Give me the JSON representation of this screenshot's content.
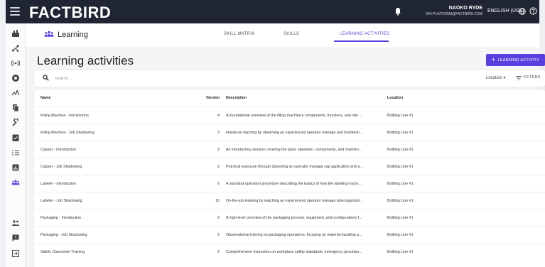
{
  "app": {
    "logo": "FACTBIRD",
    "user_name": "NAOKO RYDE",
    "user_email": "NR+PLATFORM@FACTBIRD.COM",
    "language": "ENGLISH (US)"
  },
  "sidebar": {
    "items": [
      "dashboard-icon",
      "flow-icon",
      "sensor-icon",
      "settings-dial-icon",
      "activity-icon",
      "documents-icon",
      "wrench-icon",
      "checklist-icon",
      "list-icon",
      "report-icon",
      "learning-icon",
      "people-icon",
      "feedback-icon",
      "logout-icon"
    ]
  },
  "header": {
    "section_title": "Learning",
    "tabs": [
      {
        "label": "SKILL MATRIX",
        "active": false
      },
      {
        "label": "SKILLS",
        "active": false
      },
      {
        "label": "LEARNING ACTIVITIES",
        "active": true
      }
    ]
  },
  "main": {
    "title": "Learning activities",
    "add_button_label": "LEARNING ACTIVITY",
    "search_placeholder": "Search...",
    "location_filter_label": "Location",
    "filters_label": "FILTERS"
  },
  "table": {
    "columns": [
      "Name",
      "Version",
      "Description",
      "Location"
    ],
    "rows": [
      {
        "name": "Filling Machine - Introduction",
        "version": "4",
        "description": "A foundational overview of the filling machine's components, functions, and role ...",
        "location": "Bottling Line #1"
      },
      {
        "name": "Filling Machine - Job Shadowing",
        "version": "3",
        "description": "Hands-on learning by observing an experienced operator manage and troublesh...",
        "location": "Bottling Line #1"
      },
      {
        "name": "Capper - Introduction",
        "version": "2",
        "description": "An introductory session covering the basic operation, components, and mainten...",
        "location": "Bottling Line #1"
      },
      {
        "name": "Capper - Job Shadowing",
        "version": "2",
        "description": "Practical exposure through observing an operator manage cap application and a...",
        "location": "Bottling Line #1"
      },
      {
        "name": "Labeler - Introduction",
        "version": "6",
        "description": "A standard operation procedure describing the basics of how the labeling machi...",
        "location": "Bottling Line #1"
      },
      {
        "name": "Labeler - Job Shadowing",
        "version": "10",
        "description": "On-the-job learning by watching an experienced operator manage label applicati...",
        "location": "Bottling Line #1"
      },
      {
        "name": "Packaging - Introduction",
        "version": "2",
        "description": "A high-level overview of the packaging process, equipment, and configurations f...",
        "location": "Bottling Line #1"
      },
      {
        "name": "Packaging - Job Shadowing",
        "version": "2",
        "description": "Observational training on packaging operations, focusing on material handling a...",
        "location": "Bottling Line #1"
      },
      {
        "name": "Safety Classroom Training",
        "version": "2",
        "description": "Comprehensive instruction on workplace safety standards, emergency procedur...",
        "location": "Bottling Line #1"
      }
    ]
  },
  "colors": {
    "accent": "#5b3fe0",
    "topbar": "#1f2532"
  }
}
